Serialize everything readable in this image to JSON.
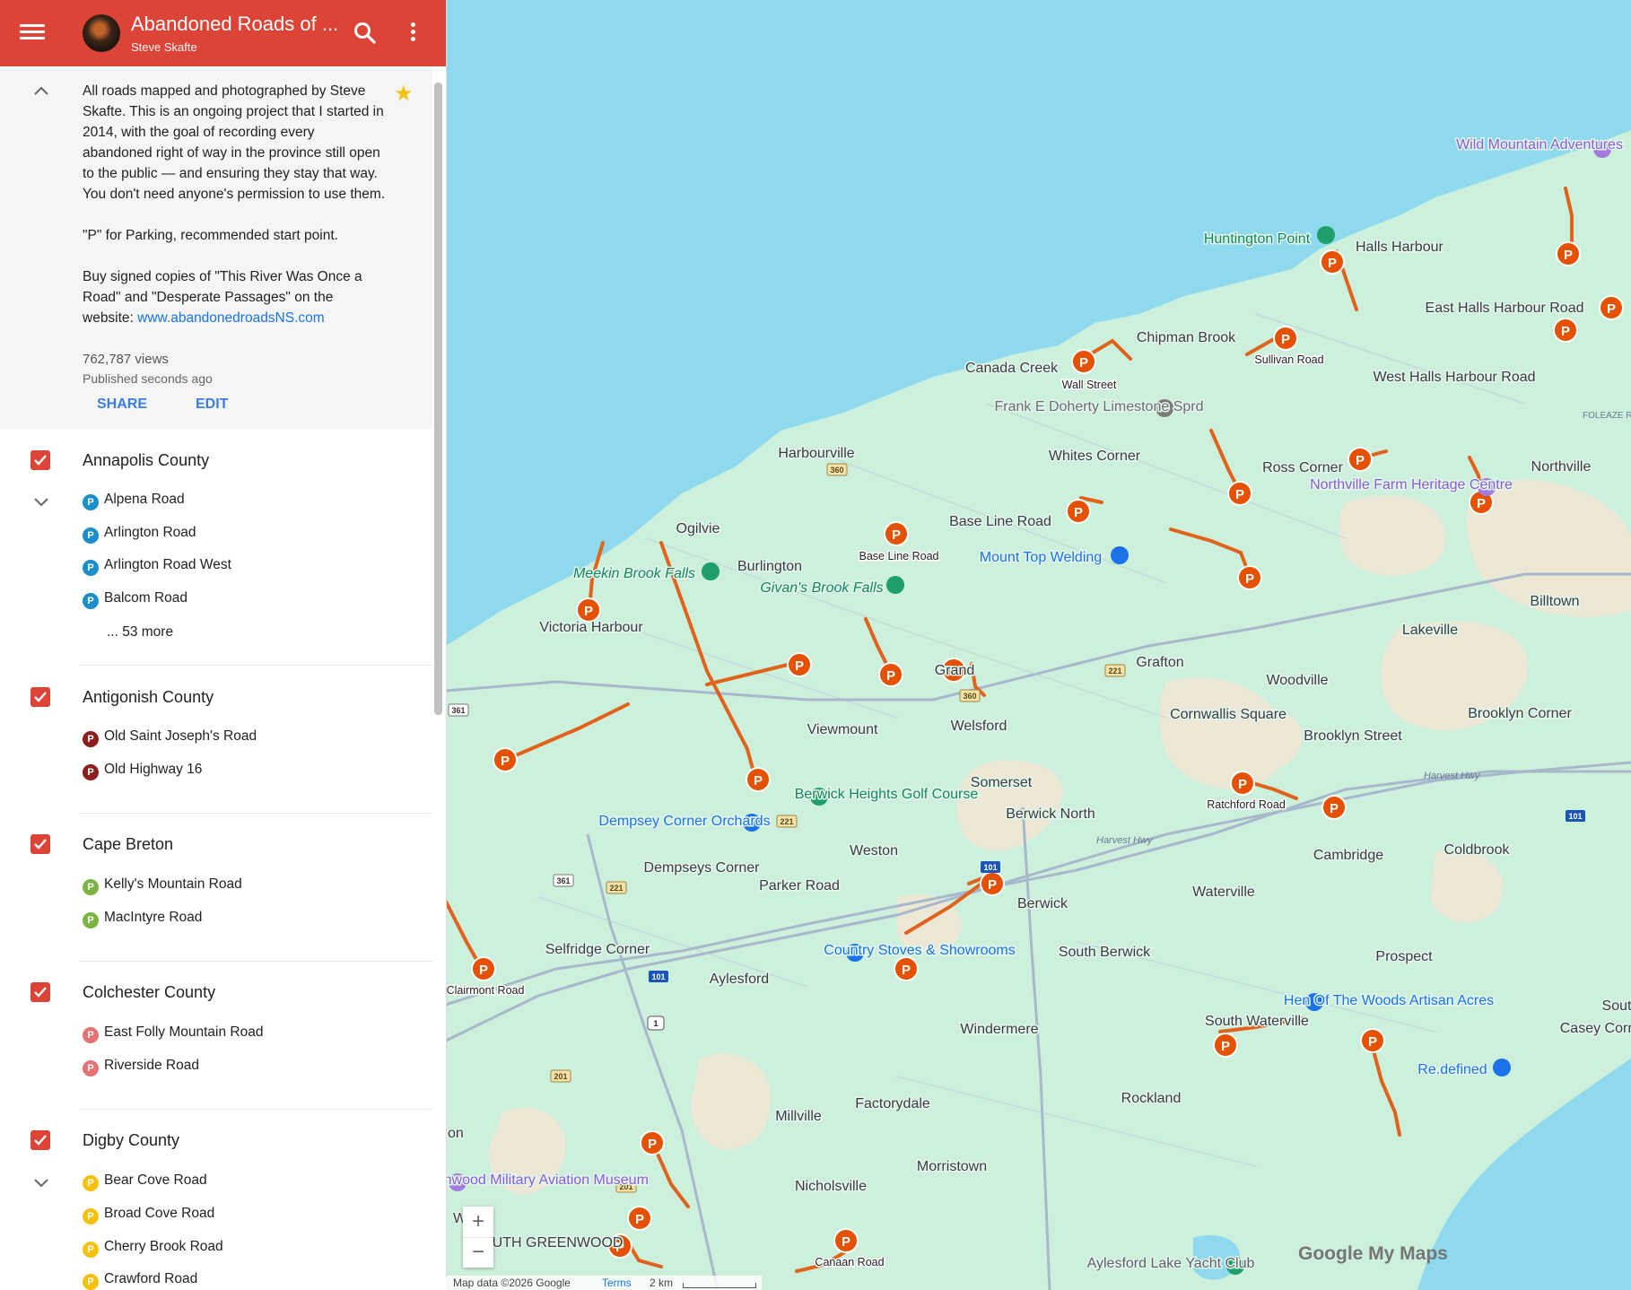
{
  "header": {
    "title": "Abandoned Roads of ...",
    "owner": "Steve Skafte"
  },
  "description": {
    "text": "All roads mapped and photographed by Steve Skafte. This is an ongoing project that I started in 2014, with the goal of recording every abandoned right of way in the province still open to the public — and ensuring they stay that way. You don't need anyone's permission to use them.\n\n\"P\" for Parking, recommended start point.\n\nBuy signed copies of \"This River Was Once a Road\" and \"Desperate Passages\" on the website: ",
    "link": "www.abandonedroadsNS.com",
    "views": "762,787 views",
    "published": "Published seconds ago",
    "share_label": "SHARE",
    "edit_label": "EDIT"
  },
  "layers": [
    {
      "name": "Annapolis County",
      "color": "#1a8fcb",
      "items": [
        "Alpena Road",
        "Arlington Road",
        "Arlington Road West",
        "Balcom Road"
      ],
      "more": "... 53 more"
    },
    {
      "name": "Antigonish County",
      "color": "#8b1f1f",
      "items": [
        "Old Saint Joseph's Road",
        "Old Highway 16"
      ]
    },
    {
      "name": "Cape Breton",
      "color": "#7cb342",
      "items": [
        "Kelly's Mountain Road",
        "MacIntyre Road"
      ]
    },
    {
      "name": "Colchester County",
      "color": "#e57373",
      "items": [
        "East Folly Mountain Road",
        "Riverside Road"
      ]
    },
    {
      "name": "Digby County",
      "color": "#f4c20d",
      "items": [
        "Bear Cove Road",
        "Broad Cove Road",
        "Cherry Brook Road",
        "Crawford Road"
      ]
    }
  ],
  "map": {
    "places": [
      "Halls Harbour",
      "Chipman Brook",
      "Canada Creek",
      "East Halls Harbour Road",
      "West Halls Harbour Road",
      "Harbourville",
      "Whites Corner",
      "Ross Corner",
      "Northville",
      "Ogilvie",
      "Burlington",
      "Base Line Road",
      "Billtown",
      "Lakeville",
      "Grafton",
      "Woodville",
      "Cornwallis Square",
      "Brooklyn Street",
      "Brooklyn Corner",
      "Viewmount",
      "Welsford",
      "Somerset",
      "Berwick North",
      "Weston",
      "Dempseys Corner",
      "Parker Road",
      "Berwick",
      "Waterville",
      "Cambridge",
      "Coldbrook",
      "Selfridge Corner",
      "Aylesford",
      "South Berwick",
      "Prospect",
      "Windermere",
      "South Waterville",
      "Casey Corn",
      "Millville",
      "Factorydale",
      "Rockland",
      "Morristown",
      "Nicholsville",
      "Victoria Harbour",
      "Grand",
      "Sout",
      "SOUTH GREENWOOD",
      "Wo",
      "on"
    ],
    "pois": [
      "Wild Mountain Adventures",
      "Huntington Point",
      "Frank E Doherty Limestone Sprd",
      "Northville Farm Heritage Centre",
      "Meekin Brook Falls",
      "Givan's Brook Falls",
      "Mount Top Welding",
      "Berwick Heights Golf Course",
      "Dempsey Corner Orchards",
      "Country Stoves & Showrooms",
      "Hen Of The Woods Artisan Acres",
      "Re.defined",
      "Greenwood Military Aviation Museum",
      "Aylesford Lake Yacht Club"
    ],
    "road_labels": [
      "Wall Street",
      "Sullivan Road",
      "Base Line Road",
      "Ratchford Road",
      "Clairmont Road",
      "Canaan Road"
    ],
    "street_names": [
      "Harvest Hwy",
      "Harvest Hwy",
      "FOLEAZE R"
    ],
    "shields": [
      "360",
      "360",
      "221",
      "361",
      "361",
      "221",
      "221",
      "101",
      "101",
      "101",
      "1",
      "201",
      "201"
    ],
    "parking_symbol": "P",
    "zoom_in": "+",
    "zoom_out": "−",
    "attribution": {
      "data": "Map data ©2026 Google",
      "terms": "Terms",
      "scale": "2 km"
    },
    "brand": "Google My Maps",
    "colors": {
      "water": "#8fd9ef",
      "land": "#cdf0dc",
      "road": "#a7b7cc",
      "trail": "#e0621b",
      "header": "#db4437"
    }
  }
}
